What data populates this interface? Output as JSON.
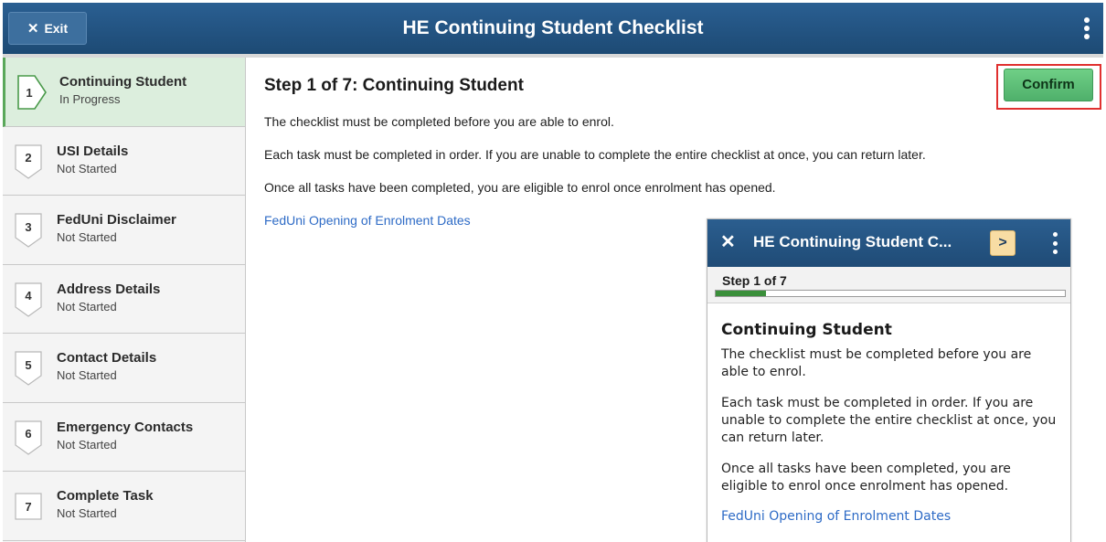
{
  "header": {
    "exit_icon": "✕",
    "exit_label": "Exit",
    "title": "HE Continuing Student Checklist",
    "menu_icon": "kebab-vertical-icon"
  },
  "sidebar": {
    "items": [
      {
        "number": "1",
        "title": "Continuing Student",
        "status": "In Progress",
        "active": true
      },
      {
        "number": "2",
        "title": "USI Details",
        "status": "Not Started",
        "active": false
      },
      {
        "number": "3",
        "title": "FedUni Disclaimer",
        "status": "Not Started",
        "active": false
      },
      {
        "number": "4",
        "title": "Address Details",
        "status": "Not Started",
        "active": false
      },
      {
        "number": "5",
        "title": "Contact Details",
        "status": "Not Started",
        "active": false
      },
      {
        "number": "6",
        "title": "Emergency Contacts",
        "status": "Not Started",
        "active": false
      },
      {
        "number": "7",
        "title": "Complete Task",
        "status": "Not Started",
        "active": false
      }
    ]
  },
  "main": {
    "title": "Step 1 of 7: Continuing Student",
    "confirm_label": "Confirm",
    "paragraphs": [
      "The checklist must be completed before you are able to enrol.",
      "Each task must be completed in order.  If you are unable to complete the entire checklist at once, you can return later.",
      "Once all tasks have been completed, you are eligible to enrol once enrolment has opened."
    ],
    "link": "FedUni Opening of Enrolment Dates"
  },
  "mobile": {
    "close_icon": "✕",
    "title": "HE Continuing Student C...",
    "next_icon": ">",
    "step_text": "Step 1 of 7",
    "progress": 0.143,
    "heading": "Continuing Student",
    "paragraphs": [
      "The checklist must be completed before you are able to enrol.",
      "Each task must be completed in order.  If you are unable to complete the entire checklist at once, you can return later.",
      "Once all tasks have been completed, you are eligible to enrol once enrolment has opened."
    ],
    "link": "FedUni Opening of Enrolment Dates"
  },
  "colors": {
    "header_bg": "#1f4e79",
    "active_step_bg": "#dceedd",
    "active_step_border": "#5aa85a",
    "confirm_bg": "#5cbf75",
    "confirm_highlight": "#e0302f",
    "link": "#2e6bc6",
    "progress_fill": "#3a8f3a",
    "next_button_bg": "#f8dda4"
  }
}
